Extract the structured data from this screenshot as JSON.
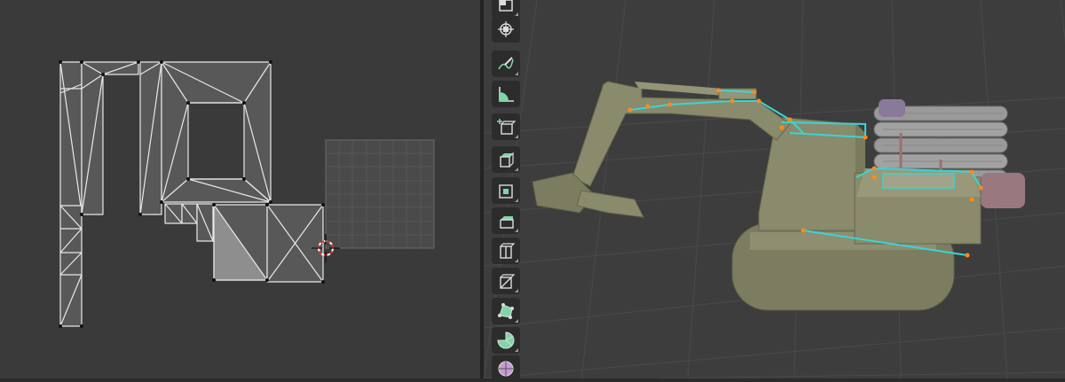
{
  "editors": {
    "left": "uv-editor",
    "right": "3d-viewport"
  },
  "colors": {
    "background_uv": "#3a3a3a",
    "background_viewport": "#3d3d3d",
    "mesh_face": "#5a5a5a",
    "mesh_face_selected": "#8e8e8e",
    "mesh_edge": "#e8e8e8",
    "seam_highlight": "#36d6d6",
    "vertex_selected": "#ff8a1a",
    "model_body": "#8a8a6c",
    "logs": "#9a9a9a",
    "accent_tool": "#7ed6a6"
  },
  "tools": [
    {
      "name": "select-box",
      "icon": "select-box-icon"
    },
    {
      "name": "cursor",
      "icon": "cursor-icon"
    },
    {
      "name": "annotate",
      "icon": "annotate-icon"
    },
    {
      "name": "measure",
      "icon": "measure-icon"
    },
    {
      "name": "add-cube",
      "icon": "add-cube-icon"
    },
    {
      "name": "extrude-region",
      "icon": "extrude-region-icon"
    },
    {
      "name": "inset-faces",
      "icon": "inset-faces-icon"
    },
    {
      "name": "bevel",
      "icon": "bevel-icon"
    },
    {
      "name": "loop-cut",
      "icon": "loop-cut-icon"
    },
    {
      "name": "knife",
      "icon": "knife-icon"
    },
    {
      "name": "poly-build",
      "icon": "poly-build-icon"
    },
    {
      "name": "spin",
      "icon": "spin-icon"
    },
    {
      "name": "smooth",
      "icon": "smooth-icon"
    }
  ]
}
